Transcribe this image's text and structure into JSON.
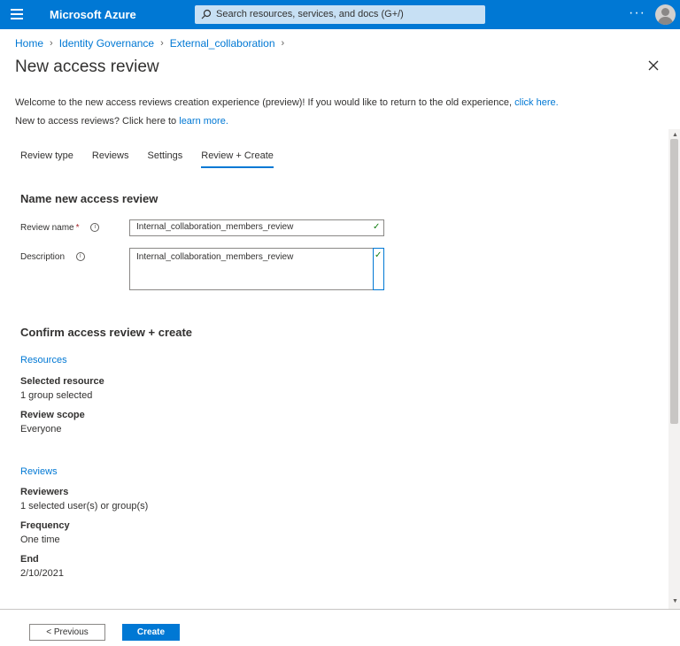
{
  "header": {
    "brand": "Microsoft Azure",
    "search_placeholder": "Search resources, services, and docs (G+/)",
    "more": "···",
    "accent": "#0078d4"
  },
  "breadcrumb": [
    "Home",
    "Identity Governance",
    "External_collaboration"
  ],
  "page": {
    "title": "New access review",
    "welcome_text": "Welcome to the new access reviews creation experience (preview)! If you would like to return to the old experience,",
    "welcome_link": "click here.",
    "new_text": "New to access reviews? Click here to",
    "new_link": "learn more."
  },
  "tabs": [
    {
      "label": "Review type",
      "active": false
    },
    {
      "label": "Reviews",
      "active": false
    },
    {
      "label": "Settings",
      "active": false
    },
    {
      "label": "Review + Create",
      "active": true
    }
  ],
  "name_section": {
    "heading": "Name new access review",
    "review_name_label": "Review name",
    "required_mark": "*",
    "review_name_value": "Internal_collaboration_members_review",
    "description_label": "Description",
    "description_value": "Internal_collaboration_members_review"
  },
  "confirm": {
    "heading": "Confirm access review + create",
    "resources_link": "Resources",
    "selected_resource_label": "Selected resource",
    "selected_resource_value": "1 group selected",
    "review_scope_label": "Review scope",
    "review_scope_value": "Everyone",
    "reviews_link": "Reviews",
    "reviewers_label": "Reviewers",
    "reviewers_value": "1 selected user(s) or group(s)",
    "frequency_label": "Frequency",
    "frequency_value": "One time",
    "end_label": "End",
    "end_value": "2/10/2021"
  },
  "footer": {
    "previous": "< Previous",
    "create": "Create"
  }
}
